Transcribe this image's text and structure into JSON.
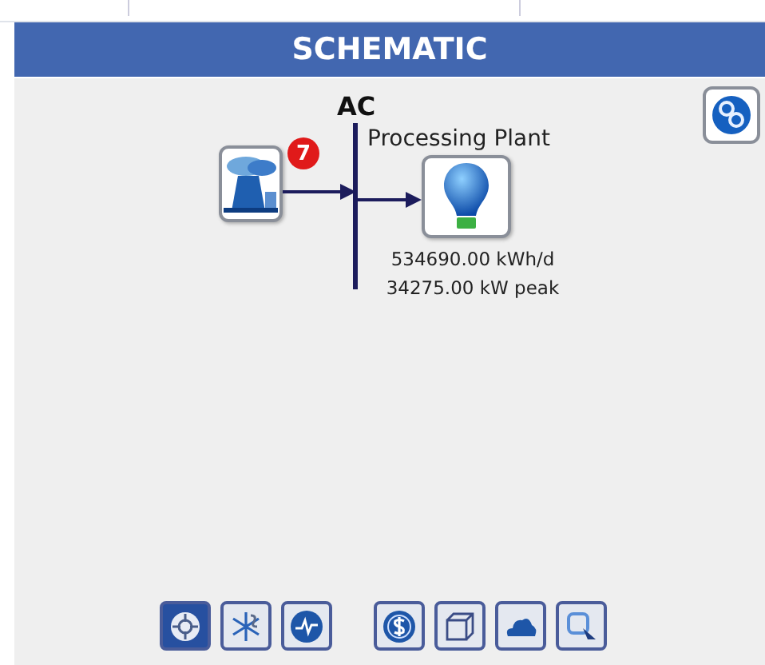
{
  "header": {
    "title": "SCHEMATIC"
  },
  "schematic": {
    "bus": {
      "label": "AC"
    },
    "generator": {
      "badge": "7"
    },
    "load": {
      "name": "Processing Plant",
      "readings": [
        "534690.00 kWh/d",
        "34275.00 kW peak"
      ]
    }
  },
  "toolbar": [
    {
      "kind": "target",
      "selected": true
    },
    {
      "kind": "wind",
      "selected": false
    },
    {
      "kind": "wave",
      "selected": false
    },
    {
      "kind": "dollar",
      "selected": false
    },
    {
      "kind": "cube",
      "selected": false
    },
    {
      "kind": "cloud",
      "selected": false
    },
    {
      "kind": "zoom",
      "selected": false
    }
  ]
}
